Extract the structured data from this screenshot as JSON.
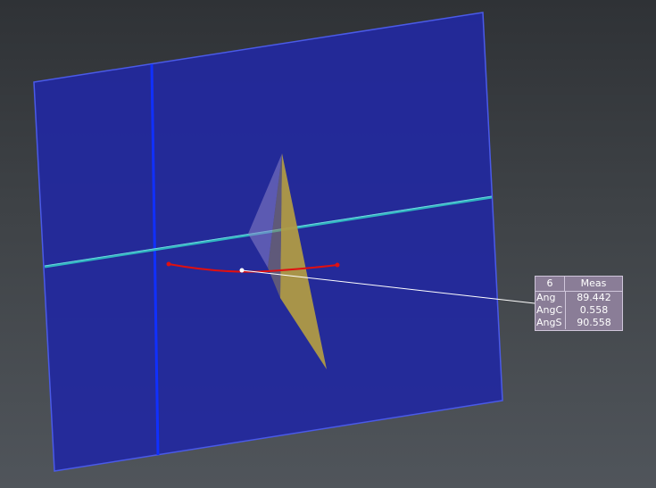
{
  "measurement": {
    "id": "6",
    "title": "Meas",
    "rows": [
      {
        "label": "Ang",
        "value": "89.442"
      },
      {
        "label": "AngC",
        "value": "0.558"
      },
      {
        "label": "AngS",
        "value": "90.558"
      }
    ]
  },
  "colors": {
    "background": "#3f4347",
    "plane": "#2228a0",
    "plane_edge": "#4a5ae8",
    "vertical_axis": "#1030ff",
    "horizontal_axis": "#2fb4c0",
    "triangle": "#b09a45",
    "triangle_shadow": "#8078b8",
    "arc": "#e01010",
    "leader": "#ffffff",
    "panel": "#8a7d97"
  }
}
